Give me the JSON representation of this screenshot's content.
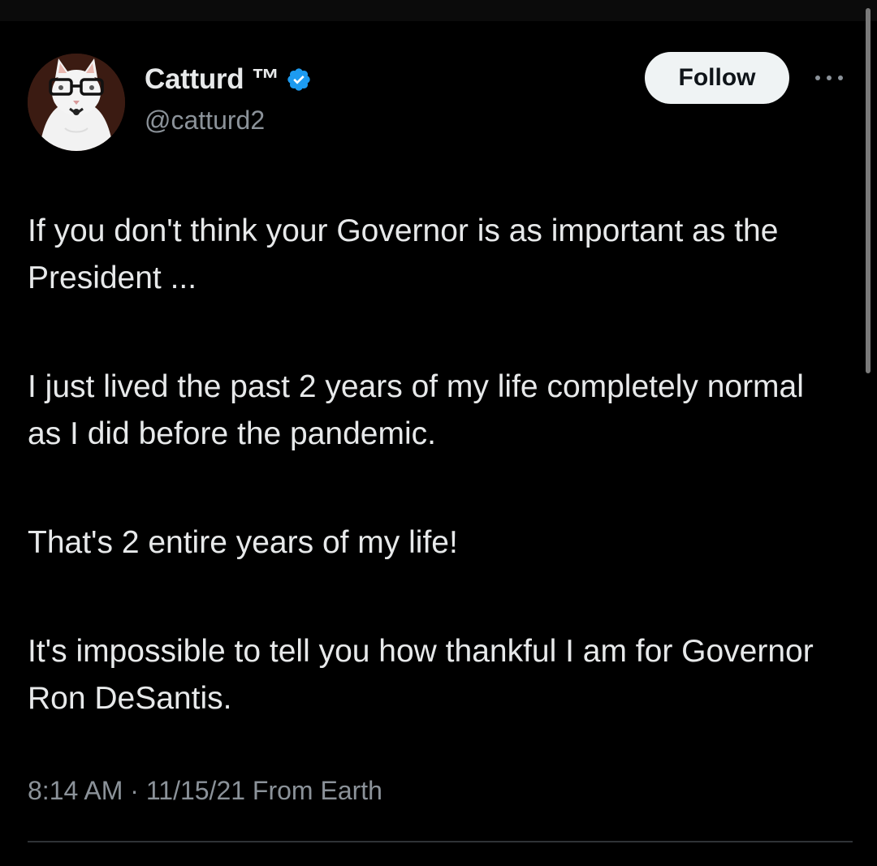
{
  "author": {
    "display_name": "Catturd ™",
    "handle": "@catturd2",
    "avatar_icon": "cat-with-glasses-avatar",
    "verified_icon": "verified-badge-icon"
  },
  "actions": {
    "follow_label": "Follow",
    "more_icon": "more-options-icon"
  },
  "tweet": {
    "paragraphs": [
      "If you don't think your Governor is as important as the President ...",
      "I just lived the past 2 years of my life completely normal as I did before the pandemic.",
      "That's 2 entire years of my life!",
      "It's impossible to tell you how thankful I am for Governor Ron DeSantis."
    ],
    "time": "8:14 AM",
    "separator": " · ",
    "date": "11/15/21",
    "source": "From Earth"
  },
  "colors": {
    "background": "#000000",
    "text_primary": "#e7e9ea",
    "text_secondary": "#8b9299",
    "verified_blue": "#1d9bf0",
    "follow_bg": "#eff3f4"
  }
}
